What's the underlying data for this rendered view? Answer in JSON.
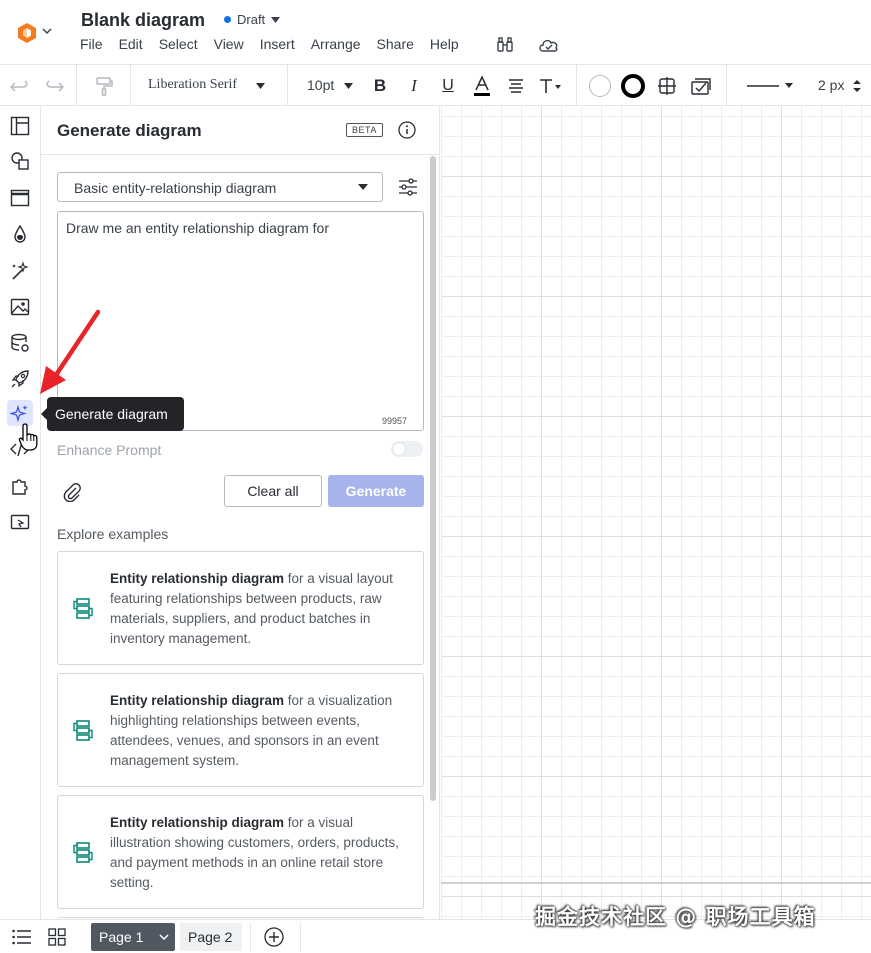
{
  "app": {
    "doc_title": "Blank diagram",
    "status": "Draft",
    "menus": [
      "File",
      "Edit",
      "Select",
      "View",
      "Insert",
      "Arrange",
      "Share",
      "Help"
    ]
  },
  "toolbar": {
    "font": "Liberation Serif",
    "font_size": "10pt",
    "line_width": "2 px"
  },
  "rail": {
    "tooltip": "Generate diagram"
  },
  "panel": {
    "title": "Generate diagram",
    "beta": "BETA",
    "diagram_type": "Basic entity-relationship diagram",
    "prompt_text": "Draw me an entity relationship diagram for",
    "char_counter": "99957",
    "enhance_label": "Enhance Prompt",
    "clear_label": "Clear all",
    "generate_label": "Generate",
    "explore_label": "Explore examples",
    "examples": [
      {
        "bold": "Entity relationship diagram",
        "text": " for a visual layout featuring relationships between products, raw materials, suppliers, and product batches in inventory management."
      },
      {
        "bold": "Entity relationship diagram",
        "text": " for a visualization highlighting relationships between events, attendees, venues, and sponsors in an event management system."
      },
      {
        "bold": "Entity relationship diagram",
        "text": " for a visual illustration showing customers, orders, products, and payment methods in an online retail store setting."
      }
    ]
  },
  "pages": {
    "page1": "Page 1",
    "page2": "Page 2"
  },
  "watermark": "掘金技术社区 @ 职场工具箱",
  "colors": {
    "accent": "#1071e5",
    "generate_disabled": "#a7b3eb",
    "example_icon": "#0c8a7a",
    "annotation_arrow": "#e8232a"
  }
}
